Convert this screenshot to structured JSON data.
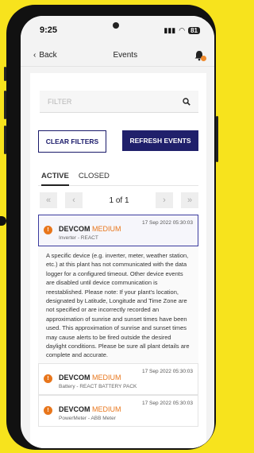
{
  "status": {
    "time": "9:25",
    "battery": "81"
  },
  "nav": {
    "back_label": "Back",
    "title": "Events"
  },
  "search": {
    "placeholder": "FILTER"
  },
  "buttons": {
    "clear": "CLEAR FILTERS",
    "refresh": "REFRESH EVENTS"
  },
  "tabs": [
    {
      "label": "ACTIVE"
    },
    {
      "label": "CLOSED"
    }
  ],
  "pager": {
    "text": "1 of 1"
  },
  "events": [
    {
      "device": "DEVCOM",
      "severity": "MEDIUM",
      "date": "17 Sep 2022 05:30:03",
      "source": "Inverter - REACT"
    },
    {
      "device": "DEVCOM",
      "severity": "MEDIUM",
      "date": "17 Sep 2022 05:30:03",
      "source": "Battery - REACT BATTERY PACK"
    },
    {
      "device": "DEVCOM",
      "severity": "MEDIUM",
      "date": "17 Sep 2022 05:30:03",
      "source": "PowerMeter - ABB Meter"
    }
  ],
  "description": "A specific device (e.g. inverter, meter, weather station, etc.) at this plant has not communicated with the data logger for a configured timeout. Other device events are disabled until device communication is reestablished. Please note: If your plant's location, designated by Latitude, Longitude and Time Zone are not specified or are incorrectly recorded an approximation of sunrise and sunset times have been used. This approximation of sunrise and sunset times may cause alerts to be fired outside the desired daylight conditions. Please be sure all plant details are complete and accurate.",
  "colors": {
    "background": "#f7e31d",
    "accent": "#20206b",
    "severity": "#e8761c"
  }
}
